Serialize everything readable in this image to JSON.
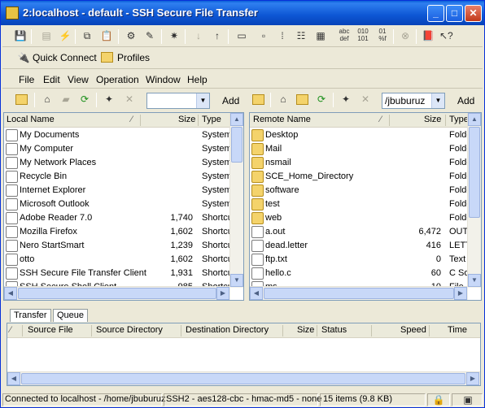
{
  "window": {
    "title": "2:localhost - default - SSH Secure File Transfer"
  },
  "toolbar_icons": [
    "save-icon",
    "print-icon",
    "disconnect-icon",
    "copy-icon",
    "paste-icon",
    "settings-icon",
    "profile-icon",
    "transfer-icon",
    "download-icon",
    "upload-icon",
    "window-icon",
    "text-mode-icon",
    "auto-mode-icon",
    "binary-mode-icon",
    "large-icons-icon",
    "hex-icon",
    "stop-icon",
    "help-book-icon",
    "whatsthis-icon"
  ],
  "quickbar": {
    "quick_connect": "Quick Connect",
    "profiles": "Profiles"
  },
  "menu": [
    "File",
    "Edit",
    "View",
    "Operation",
    "Window",
    "Help"
  ],
  "local": {
    "path_value": "",
    "add": "Add",
    "columns": {
      "name": "Local Name",
      "size": "Size",
      "type": "Type"
    },
    "rows": [
      {
        "name": "My Documents",
        "size": "",
        "type": "System"
      },
      {
        "name": "My Computer",
        "size": "",
        "type": "System"
      },
      {
        "name": "My Network Places",
        "size": "",
        "type": "System"
      },
      {
        "name": "Recycle Bin",
        "size": "",
        "type": "System"
      },
      {
        "name": "Internet Explorer",
        "size": "",
        "type": "System"
      },
      {
        "name": "Microsoft Outlook",
        "size": "",
        "type": "System"
      },
      {
        "name": "Adobe Reader 7.0",
        "size": "1,740",
        "type": "Shortcut"
      },
      {
        "name": "Mozilla Firefox",
        "size": "1,602",
        "type": "Shortcut"
      },
      {
        "name": "Nero StartSmart",
        "size": "1,239",
        "type": "Shortcut"
      },
      {
        "name": "otto",
        "size": "1,602",
        "type": "Shortcut"
      },
      {
        "name": "SSH Secure File Transfer Client",
        "size": "1,931",
        "type": "Shortcut"
      },
      {
        "name": "SSH Secure Shell Client",
        "size": "985",
        "type": "Shortcut"
      }
    ]
  },
  "remote": {
    "path_value": "/jbuburuz",
    "add": "Add",
    "columns": {
      "name": "Remote Name",
      "size": "Size",
      "type": "Type"
    },
    "rows": [
      {
        "name": "Desktop",
        "size": "",
        "type": "Folder"
      },
      {
        "name": "Mail",
        "size": "",
        "type": "Folder"
      },
      {
        "name": "nsmail",
        "size": "",
        "type": "Folder"
      },
      {
        "name": "SCE_Home_Directory",
        "size": "",
        "type": "Folder"
      },
      {
        "name": "software",
        "size": "",
        "type": "Folder"
      },
      {
        "name": "test",
        "size": "",
        "type": "Folder"
      },
      {
        "name": "web",
        "size": "",
        "type": "Folder"
      },
      {
        "name": "a.out",
        "size": "6,472",
        "type": "OUT"
      },
      {
        "name": "dead.letter",
        "size": "416",
        "type": "LETTER"
      },
      {
        "name": "ftp.txt",
        "size": "0",
        "type": "Text"
      },
      {
        "name": "hello.c",
        "size": "60",
        "type": "C Source"
      },
      {
        "name": "ms",
        "size": "10",
        "type": "File"
      }
    ]
  },
  "tabs": [
    "Transfer",
    "Queue"
  ],
  "queue_columns": [
    "Source File",
    "Source Directory",
    "Destination Directory",
    "Size",
    "Status",
    "Speed",
    "Time"
  ],
  "status": {
    "connection": "Connected to localhost - /home/jbuburuz",
    "cipher": "SSH2 - aes128-cbc - hmac-md5 - none",
    "items": "15 items (9.8 KB)"
  }
}
